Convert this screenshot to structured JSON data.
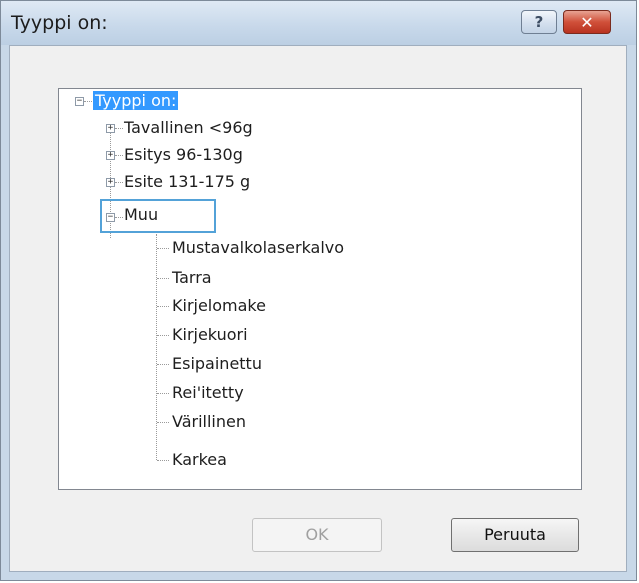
{
  "window": {
    "title": "Tyyppi on:",
    "help_glyph": "?",
    "close_glyph": "✕"
  },
  "tree": {
    "root": {
      "label": "Tyyppi on:",
      "expanded": true,
      "selected": true
    },
    "groups": [
      {
        "label": "Tavallinen <96g",
        "expanded": false
      },
      {
        "label": "Esitys 96-130g",
        "expanded": false
      },
      {
        "label": "Esite 131-175 g",
        "expanded": false
      },
      {
        "label": "Muu",
        "expanded": true,
        "focused": true
      }
    ],
    "muu_children": [
      "Mustavalkolaserkalvo",
      "Tarra",
      "Kirjelomake",
      "Kirjekuori",
      "Esipainettu",
      "Rei'itetty",
      "Värillinen",
      "Karkea"
    ]
  },
  "buttons": {
    "ok_label": "OK",
    "ok_enabled": false,
    "cancel_label": "Peruuta"
  },
  "colors": {
    "selection": "#3399ff",
    "focus_border": "#53a2d8",
    "close_button": "#c7422c"
  }
}
